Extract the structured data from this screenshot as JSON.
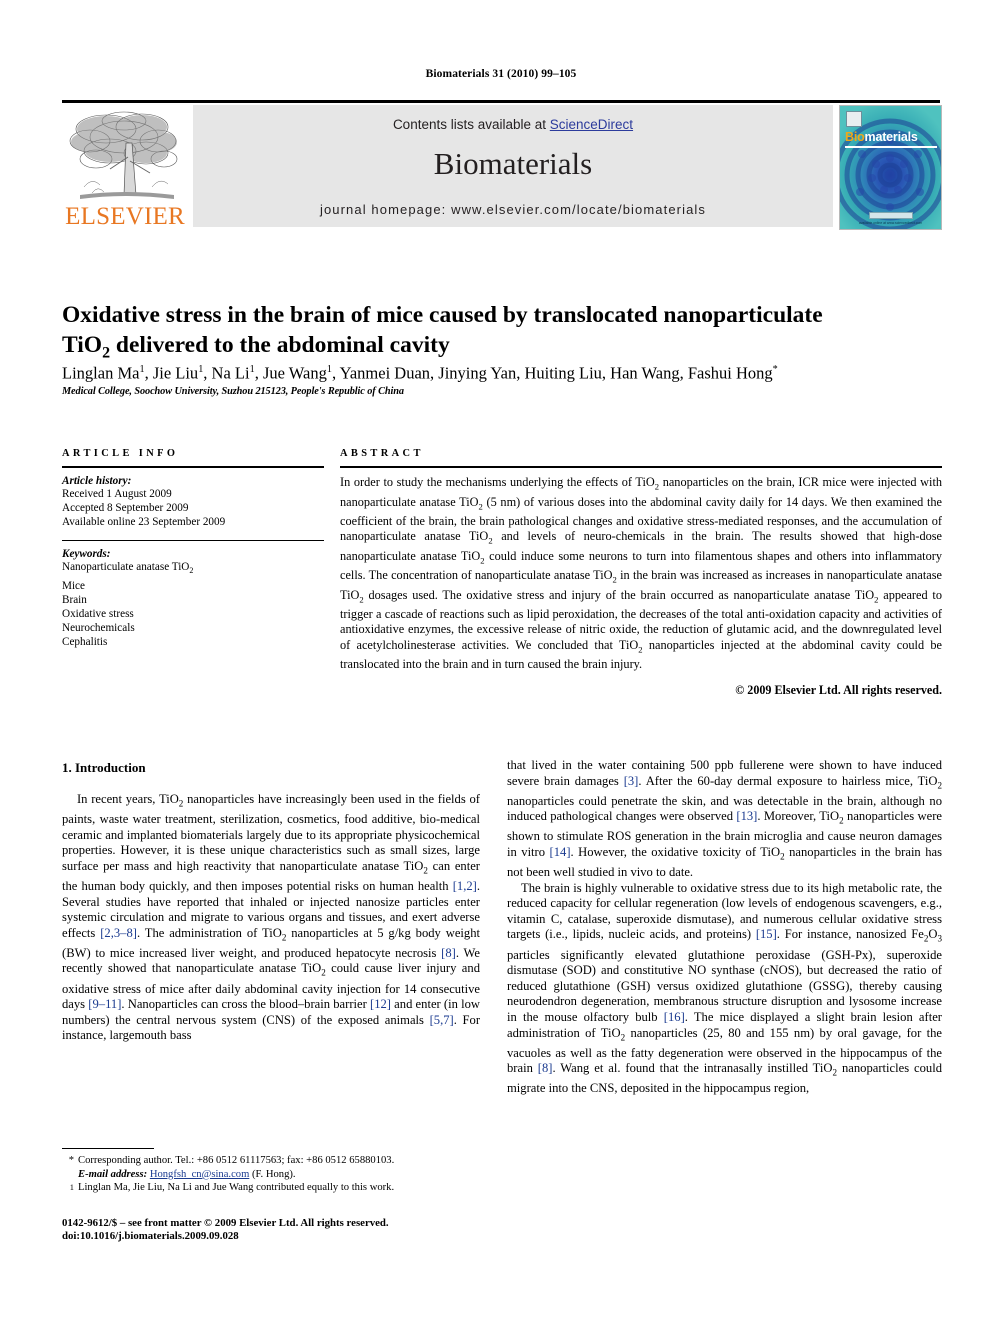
{
  "running_head": "Biomaterials 31 (2010) 99–105",
  "masthead": {
    "contents_prefix": "Contents lists available at ",
    "sciencedirect": "ScienceDirect",
    "journal_name": "Biomaterials",
    "homepage": "journal homepage: www.elsevier.com/locate/biomaterials",
    "publisher_wordmark": "ELSEVIER",
    "cover": {
      "title_bio": "Bio",
      "title_materials": "materials",
      "footer_text": "available online at www.sciencedirect.com"
    },
    "colors": {
      "elsevier_orange": "#E87722",
      "link_blue": "#2c3b9c",
      "banner_gray": "#e6e6e6",
      "cover_teal": "#2fb3b8"
    }
  },
  "article": {
    "title_line1": "Oxidative stress in the brain of mice caused by translocated nanoparticulate",
    "title_line2_pre": "TiO",
    "title_line2_sub": "2",
    "title_line2_post": " delivered to the abdominal cavity",
    "authors": "Linglan Ma 1, Jie Liu 1, Na Li 1, Jue Wang 1, Yanmei Duan, Jinying Yan, Huiting Liu, Han Wang, Fashui Hong*",
    "affiliation": "Medical College, Soochow University, Suzhou 215123, People's Republic of China"
  },
  "article_info": {
    "heading": "ARTICLE INFO",
    "history_label": "Article history:",
    "history": [
      "Received 1 August 2009",
      "Accepted 8 September 2009",
      "Available online 23 September 2009"
    ],
    "keywords_label": "Keywords:",
    "keywords": [
      "Nanoparticulate anatase TiO2",
      "Mice",
      "Brain",
      "Oxidative stress",
      "Neurochemicals",
      "Cephalitis"
    ]
  },
  "abstract": {
    "heading": "ABSTRACT",
    "text": "In order to study the mechanisms underlying the effects of TiO2 nanoparticles on the brain, ICR mice were injected with nanoparticulate anatase TiO2 (5 nm) of various doses into the abdominal cavity daily for 14 days. We then examined the coefficient of the brain, the brain pathological changes and oxidative stress-mediated responses, and the accumulation of nanoparticulate anatase TiO2 and levels of neuro-chemicals in the brain. The results showed that high-dose nanoparticulate anatase TiO2 could induce some neurons to turn into filamentous shapes and others into inflammatory cells. The concentration of nanoparticulate anatase TiO2 in the brain was increased as increases in nanoparticulate anatase TiO2 dosages used. The oxidative stress and injury of the brain occurred as nanoparticulate anatase TiO2 appeared to trigger a cascade of reactions such as lipid peroxidation, the decreases of the total anti-oxidation capacity and activities of antioxidative enzymes, the excessive release of nitric oxide, the reduction of glutamic acid, and the downregulated level of acetylcholinesterase activities. We concluded that TiO2 nanoparticles injected at the abdominal cavity could be translocated into the brain and in turn caused the brain injury.",
    "copyright": "© 2009 Elsevier Ltd. All rights reserved."
  },
  "body": {
    "section1_title": "1.  Introduction",
    "left_paragraph": "In recent years, TiO2 nanoparticles have increasingly been used in the fields of paints, waste water treatment, sterilization, cosmetics, food additive, bio-medical ceramic and implanted biomaterials largely due to its appropriate physicochemical properties. However, it is these unique characteristics such as small sizes, large surface per mass and high reactivity that nanoparticulate anatase TiO2 can enter the human body quickly, and then imposes potential risks on human health [1,2]. Several studies have reported that inhaled or injected nanosize particles enter systemic circulation and migrate to various organs and tissues, and exert adverse effects [2,3–8]. The administration of TiO2 nanoparticles at 5 g/kg body weight (BW) to mice increased liver weight, and produced hepatocyte necrosis [8]. We recently showed that nanoparticulate anatase TiO2 could cause liver injury and oxidative stress of mice after daily abdominal cavity injection for 14 consecutive days [9–11]. Nanoparticles can cross the blood–brain barrier [12] and enter (in low numbers) the central nervous system (CNS) of the exposed animals [5,7]. For instance, largemouth bass",
    "right_paragraph1": "that lived in the water containing 500 ppb fullerene were shown to have induced severe brain damages [3]. After the 60-day dermal exposure to hairless mice, TiO2 nanoparticles could penetrate the skin, and was detectable in the brain, although no induced pathological changes were observed [13]. Moreover, TiO2 nanoparticles were shown to stimulate ROS generation in the brain microglia and cause neuron damages in vitro [14]. However, the oxidative toxicity of TiO2 nanoparticles in the brain has not been well studied in vivo to date.",
    "right_paragraph2": "The brain is highly vulnerable to oxidative stress due to its high metabolic rate, the reduced capacity for cellular regeneration (low levels of endogenous scavengers, e.g., vitamin C, catalase, superoxide dismutase), and numerous cellular oxidative stress targets (i.e., lipids, nucleic acids, and proteins) [15]. For instance, nano-sized Fe2O3 particles significantly elevated glutathione peroxidase (GSH-Px), superoxide dismutase (SOD) and constitutive NO synthase (cNOS), but decreased the ratio of reduced glutathione (GSH) versus oxidized glutathione (GSSG), thereby causing neurodendron degeneration, membranous structure disruption and lysosome increase in the mouse olfactory bulb [16]. The mice displayed a slight brain lesion after administration of TiO2 nanoparticles (25, 80 and 155 nm) by oral gavage, for the vacuoles as well as the fatty degeneration were observed in the hippocampus of the brain [8]. Wang et al. found that the intranasally instilled TiO2 nanoparticles could migrate into the CNS, deposited in the hippocampus region,"
  },
  "footnotes": {
    "corresponding_marker": "*",
    "corresponding_text": "Corresponding author. Tel.: +86 0512 61117563; fax: +86 0512 65880103.",
    "email_label": "E-mail address:",
    "email": "Hongfsh_cn@sina.com",
    "email_suffix": " (F. Hong).",
    "equal_marker": "1",
    "equal_text": "Linglan Ma, Jie Liu, Na Li and Jue Wang contributed equally to this work."
  },
  "page_footer": {
    "line1": "0142-9612/$ – see front matter © 2009 Elsevier Ltd. All rights reserved.",
    "line2": "doi:10.1016/j.biomaterials.2009.09.028"
  }
}
